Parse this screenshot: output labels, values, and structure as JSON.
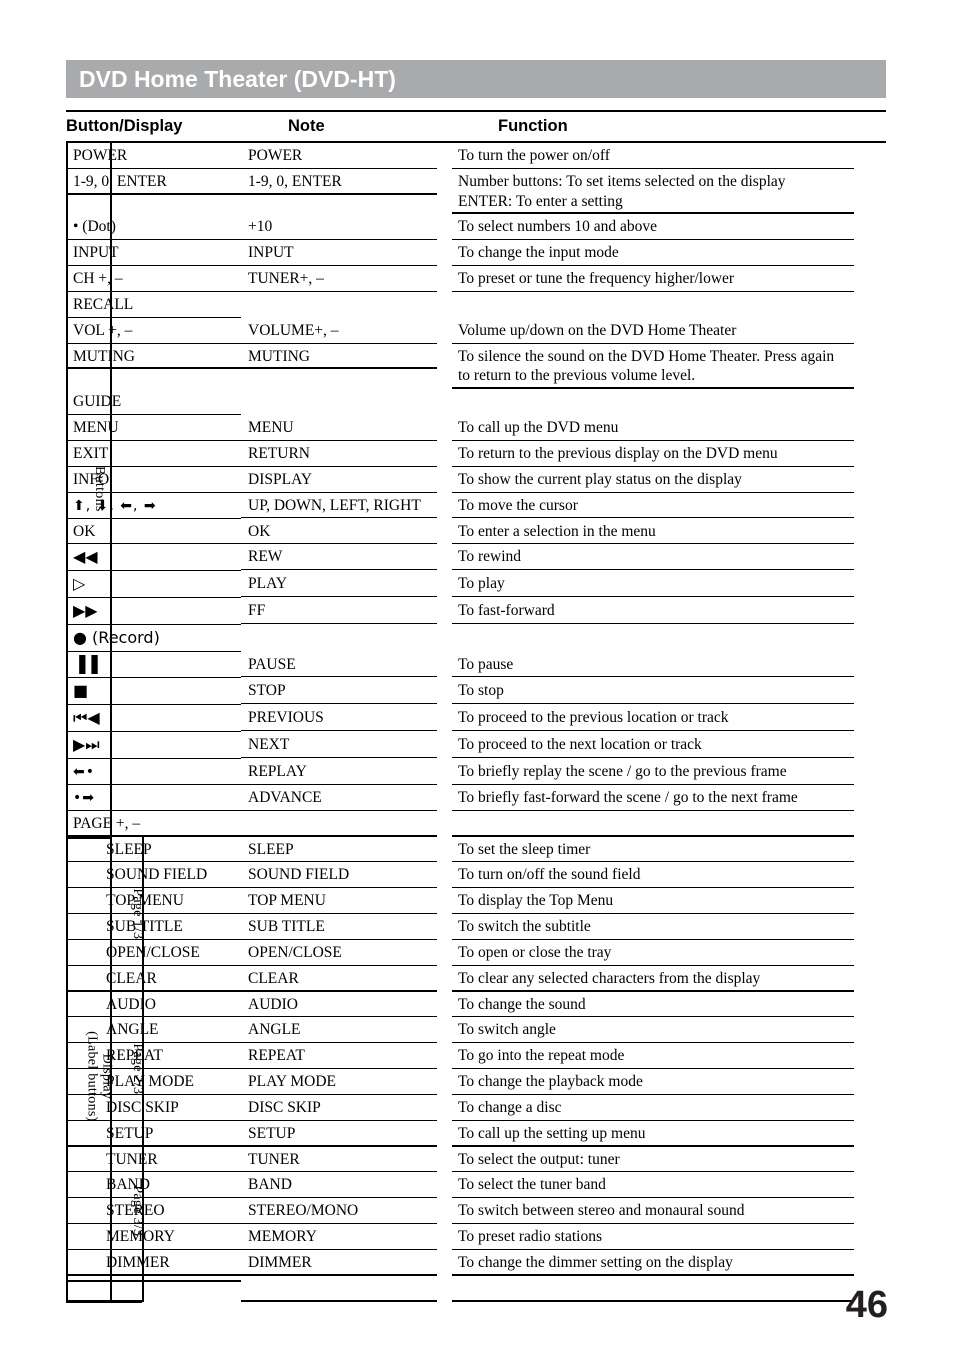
{
  "banner": {
    "title": "DVD Home Theater (DVD-HT)",
    "bg_color": "#a9aaac",
    "text_color": "#ffffff"
  },
  "columns": {
    "c1": "Button/Display",
    "c2": "Note",
    "c3": "Function"
  },
  "side_labels": {
    "buttons": "Buttons",
    "display": "Display\n(Label buttons)",
    "page1": "Page 1/3",
    "page2": "Page 2/3",
    "page3": "Page 3/3"
  },
  "rows": [
    {
      "id": "power",
      "button": "POWER",
      "note": "POWER",
      "function": "To turn the power on/off"
    },
    {
      "id": "numbers",
      "button": "1-9, 0, ENTER",
      "note": "1-9, 0, ENTER",
      "function": "Number buttons: To set items selected on the display\nENTER: To enter a setting"
    },
    {
      "id": "dot",
      "button": "• (Dot)",
      "note": "+10",
      "function": "To select numbers 10 and above"
    },
    {
      "id": "input",
      "button": "INPUT",
      "note": "INPUT",
      "function": "To change the input mode"
    },
    {
      "id": "ch",
      "button": "CH +, –",
      "note": "TUNER+, –",
      "function": "To preset or tune the frequency higher/lower"
    },
    {
      "id": "recall",
      "button": "RECALL",
      "note": "",
      "function": ""
    },
    {
      "id": "vol",
      "button": "VOL +, –",
      "note": "VOLUME+, –",
      "function": "Volume up/down on the DVD Home Theater"
    },
    {
      "id": "muting",
      "button": "MUTING",
      "note": "MUTING",
      "function": "To silence the sound on the DVD Home Theater. Press again\nto return to the previous volume level."
    },
    {
      "id": "guide",
      "button": "GUIDE",
      "note": "",
      "function": ""
    },
    {
      "id": "menu",
      "button": "MENU",
      "note": "MENU",
      "function": "To call up the DVD menu"
    },
    {
      "id": "exit",
      "button": "EXIT",
      "note": "RETURN",
      "function": "To return to the previous display on the DVD menu"
    },
    {
      "id": "info",
      "button": "INFO",
      "note": "DISPLAY",
      "function": "To show the current play status on the display"
    },
    {
      "id": "arrows",
      "button": "⬆, ⬇, ⬅, ➡",
      "note": "UP, DOWN, LEFT, RIGHT",
      "function": "To move the cursor",
      "symbol": true
    },
    {
      "id": "ok",
      "button": "OK",
      "note": "OK",
      "function": "To enter a selection in the menu"
    },
    {
      "id": "rew",
      "button": "◀◀",
      "note": "REW",
      "function": "To rewind",
      "symbol": true
    },
    {
      "id": "play",
      "button": "▷",
      "note": "PLAY",
      "function": "To play",
      "symbol": true
    },
    {
      "id": "ff",
      "button": "▶▶",
      "note": "FF",
      "function": "To fast-forward",
      "symbol": true
    },
    {
      "id": "record",
      "button": "● (Record)",
      "note": "",
      "function": "",
      "symbol": true
    },
    {
      "id": "pause",
      "button": "▐▐",
      "note": "PAUSE",
      "function": "To pause",
      "symbol": true
    },
    {
      "id": "stop",
      "button": "■",
      "note": "STOP",
      "function": "To stop",
      "symbol": true
    },
    {
      "id": "previous",
      "button": "⏮◀",
      "note": "PREVIOUS",
      "function": "To proceed to the previous location or track",
      "symbol": true
    },
    {
      "id": "next",
      "button": "▶⏭",
      "note": "NEXT",
      "function": "To proceed to the next location or track",
      "symbol": true
    },
    {
      "id": "replay",
      "button": "⬅•",
      "note": "REPLAY",
      "function": "To briefly replay the scene / go to the previous frame",
      "symbol": true
    },
    {
      "id": "advance",
      "button": "•➡",
      "note": "ADVANCE",
      "function": "To briefly fast-forward the scene / go to the next frame",
      "symbol": true
    },
    {
      "id": "page",
      "button": "PAGE +, –",
      "note": "",
      "function": ""
    },
    {
      "id": "sleep",
      "button": "SLEEP",
      "note": "SLEEP",
      "function": "To set the sleep timer"
    },
    {
      "id": "soundfield",
      "button": "SOUND FIELD",
      "note": "SOUND FIELD",
      "function": "To turn on/off the sound field"
    },
    {
      "id": "topmenu",
      "button": "TOP MENU",
      "note": "TOP MENU",
      "function": "To display the Top Menu"
    },
    {
      "id": "subtitle",
      "button": "SUB TITLE",
      "note": "SUB TITLE",
      "function": "To switch the subtitle"
    },
    {
      "id": "openclose",
      "button": "OPEN/CLOSE",
      "note": "OPEN/CLOSE",
      "function": "To open or close the tray"
    },
    {
      "id": "clear",
      "button": "CLEAR",
      "note": "CLEAR",
      "function": "To clear any selected characters from the display"
    },
    {
      "id": "audio",
      "button": "AUDIO",
      "note": "AUDIO",
      "function": "To change the sound"
    },
    {
      "id": "angle",
      "button": "ANGLE",
      "note": "ANGLE",
      "function": "To switch angle"
    },
    {
      "id": "repeat",
      "button": "REPEAT",
      "note": "REPEAT",
      "function": "To go into the repeat mode"
    },
    {
      "id": "playmode",
      "button": "PLAY MODE",
      "note": "PLAY MODE",
      "function": "To change the playback mode"
    },
    {
      "id": "discskip",
      "button": "DISC SKIP",
      "note": "DISC SKIP",
      "function": "To change a disc"
    },
    {
      "id": "setup",
      "button": "SETUP",
      "note": "SETUP",
      "function": "To call up the setting up menu"
    },
    {
      "id": "tuner",
      "button": "TUNER",
      "note": "TUNER",
      "function": "To select the output: tuner"
    },
    {
      "id": "band",
      "button": "BAND",
      "note": "BAND",
      "function": "To select the tuner band"
    },
    {
      "id": "stereo",
      "button": "STEREO",
      "note": "STEREO/MONO",
      "function": "To switch between stereo and monaural sound"
    },
    {
      "id": "memory",
      "button": "MEMORY",
      "note": "MEMORY",
      "function": "To preset radio stations"
    },
    {
      "id": "dimmer",
      "button": "DIMMER",
      "note": "DIMMER",
      "function": "To change the dimmer setting on the display"
    },
    {
      "id": "blank",
      "button": "",
      "note": "",
      "function": ""
    }
  ],
  "page_number": "46"
}
